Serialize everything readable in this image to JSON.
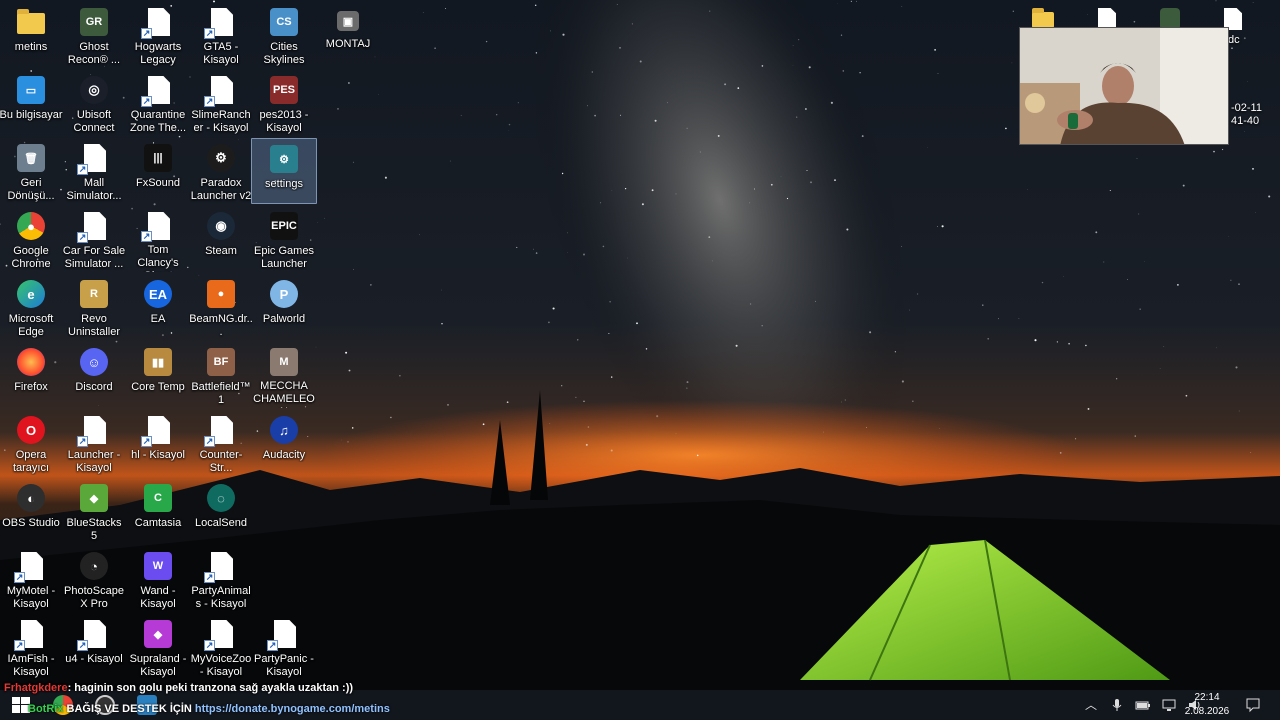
{
  "desktop": {
    "icons": [
      {
        "id": "metins",
        "label": "metins",
        "kind": "folder",
        "col": 0,
        "row": 0,
        "name": "folder-icon"
      },
      {
        "id": "ghostrecon",
        "label": "Ghost Recon® ...",
        "kind": "sq",
        "color": "#3d5a3d",
        "glyph": "GR",
        "col": 1,
        "row": 0,
        "name": "ghost-recon-icon"
      },
      {
        "id": "hogwarts",
        "label": "Hogwarts Legacy",
        "kind": "page",
        "col": 2,
        "row": 0,
        "name": "shortcut-file-icon"
      },
      {
        "id": "gta5",
        "label": "GTA5 - Kisayol",
        "kind": "page",
        "col": 3,
        "row": 0,
        "name": "shortcut-file-icon"
      },
      {
        "id": "cities",
        "label": "Cities Skylines",
        "kind": "sq",
        "color": "#4a90c8",
        "glyph": "CS",
        "col": 4,
        "row": 0,
        "name": "cities-skylines-icon"
      },
      {
        "id": "montaj",
        "label": "MONTAJ",
        "kind": "sq",
        "color": "#6b6b6b",
        "glyph": "▣",
        "col": 5,
        "row": 0,
        "name": "montaj-icon",
        "small": true
      },
      {
        "id": "thispc",
        "label": "Bu bilgisayar",
        "kind": "sq",
        "color": "#2b8fe0",
        "glyph": "▭",
        "col": 0,
        "row": 1,
        "name": "this-pc-icon"
      },
      {
        "id": "ubisoft",
        "label": "Ubisoft Connect",
        "kind": "circ",
        "color": "#1b1f2a",
        "glyph": "◎",
        "col": 1,
        "row": 1,
        "name": "ubisoft-connect-icon"
      },
      {
        "id": "quarantine",
        "label": "Quarantine Zone The...",
        "kind": "page",
        "col": 2,
        "row": 1,
        "name": "shortcut-file-icon"
      },
      {
        "id": "slimerancher",
        "label": "SlimeRancher - Kisayol",
        "kind": "page",
        "col": 3,
        "row": 1,
        "name": "shortcut-file-icon"
      },
      {
        "id": "pes2013",
        "label": "pes2013 - Kisayol",
        "kind": "sq",
        "color": "#8a2b2b",
        "glyph": "PES",
        "col": 4,
        "row": 1,
        "name": "pes2013-icon"
      },
      {
        "id": "recycle",
        "label": "Geri Dönüşü...",
        "kind": "sq",
        "color": "#6d7f8f",
        "glyph": "🗑",
        "col": 0,
        "row": 2,
        "name": "recycle-bin-icon"
      },
      {
        "id": "mall",
        "label": "Mall Simulator...",
        "kind": "page",
        "col": 1,
        "row": 2,
        "name": "shortcut-file-icon"
      },
      {
        "id": "fxsound",
        "label": "FxSound",
        "kind": "sq",
        "color": "#111",
        "glyph": "|||",
        "col": 2,
        "row": 2,
        "name": "fxsound-icon"
      },
      {
        "id": "paradox",
        "label": "Paradox Launcher v2",
        "kind": "circ",
        "color": "#1c1c1c",
        "glyph": "⚙",
        "col": 3,
        "row": 2,
        "name": "paradox-launcher-icon"
      },
      {
        "id": "settings",
        "label": "settings",
        "kind": "sq",
        "color": "#2a7f8f",
        "glyph": "⚙",
        "col": 4,
        "row": 2,
        "name": "settings-icon",
        "selected": true
      },
      {
        "id": "chrome",
        "label": "Google Chrome",
        "kind": "circ",
        "color": "conic-gradient(#ea4335 0 33%,#fbbc05 0 66%,#34a853 0)",
        "glyph": "●",
        "col": 0,
        "row": 3,
        "name": "chrome-icon"
      },
      {
        "id": "carforsale",
        "label": "Car For Sale Simulator ...",
        "kind": "page",
        "col": 1,
        "row": 3,
        "name": "shortcut-file-icon"
      },
      {
        "id": "tomclancy",
        "label": "Tom Clancy's Ghost Reco...",
        "kind": "page",
        "col": 2,
        "row": 3,
        "name": "shortcut-file-icon"
      },
      {
        "id": "steam",
        "label": "Steam",
        "kind": "circ",
        "color": "#1b2838",
        "glyph": "◉",
        "col": 3,
        "row": 3,
        "name": "steam-icon"
      },
      {
        "id": "epic",
        "label": "Epic Games Launcher",
        "kind": "sq",
        "color": "#111",
        "glyph": "EPIC",
        "col": 4,
        "row": 3,
        "name": "epic-games-icon"
      },
      {
        "id": "edge",
        "label": "Microsoft Edge",
        "kind": "circ",
        "color": "linear-gradient(135deg,#36c46b,#1e7bd8)",
        "glyph": "e",
        "col": 0,
        "row": 4,
        "name": "edge-icon"
      },
      {
        "id": "revo",
        "label": "Revo Uninstaller",
        "kind": "sq",
        "color": "#c8a04a",
        "glyph": "R",
        "col": 1,
        "row": 4,
        "name": "revo-uninstaller-icon"
      },
      {
        "id": "ea",
        "label": "EA",
        "kind": "circ",
        "color": "#1766e0",
        "glyph": "EA",
        "col": 2,
        "row": 4,
        "name": "ea-icon"
      },
      {
        "id": "beamng",
        "label": "BeamNG.dr...",
        "kind": "sq",
        "color": "#e86a1a",
        "glyph": "●",
        "col": 3,
        "row": 4,
        "name": "beamng-icon"
      },
      {
        "id": "palworld",
        "label": "Palworld",
        "kind": "circ",
        "color": "#7fb6e6",
        "glyph": "P",
        "col": 4,
        "row": 4,
        "name": "palworld-icon"
      },
      {
        "id": "firefox",
        "label": "Firefox",
        "kind": "circ",
        "color": "radial-gradient(circle,#ffbd4f,#ff4f2e 60%,#6e2cc9)",
        "glyph": "",
        "col": 0,
        "row": 5,
        "name": "firefox-icon"
      },
      {
        "id": "discord",
        "label": "Discord",
        "kind": "circ",
        "color": "#5865f2",
        "glyph": "☺",
        "col": 1,
        "row": 5,
        "name": "discord-icon"
      },
      {
        "id": "coretemp",
        "label": "Core Temp",
        "kind": "sq",
        "color": "#b88a40",
        "glyph": "▮▮",
        "col": 2,
        "row": 5,
        "name": "core-temp-icon"
      },
      {
        "id": "battlefield",
        "label": "Battlefield™ 1",
        "kind": "sq",
        "color": "#8f6048",
        "glyph": "BF",
        "col": 3,
        "row": 5,
        "name": "battlefield-icon"
      },
      {
        "id": "meccha",
        "label": "MECCHA CHAMELEON",
        "kind": "sq",
        "color": "#8a7a70",
        "glyph": "M",
        "col": 4,
        "row": 5,
        "name": "meccha-chameleon-icon"
      },
      {
        "id": "opera",
        "label": "Opera tarayıcı",
        "kind": "circ",
        "color": "#e0141e",
        "glyph": "O",
        "col": 0,
        "row": 6,
        "name": "opera-icon"
      },
      {
        "id": "launcher",
        "label": "Launcher - Kisayol",
        "kind": "page",
        "col": 1,
        "row": 6,
        "name": "shortcut-file-icon"
      },
      {
        "id": "hl",
        "label": "hl - Kisayol",
        "kind": "page",
        "col": 2,
        "row": 6,
        "name": "shortcut-file-icon"
      },
      {
        "id": "counterstrike",
        "label": "Counter-Str...",
        "kind": "page",
        "col": 3,
        "row": 6,
        "name": "shortcut-file-icon"
      },
      {
        "id": "audacity",
        "label": "Audacity",
        "kind": "circ",
        "color": "#1a3ea8",
        "glyph": "♫",
        "col": 4,
        "row": 6,
        "name": "audacity-icon"
      },
      {
        "id": "obs",
        "label": "OBS Studio",
        "kind": "circ",
        "color": "#2e2e2e",
        "glyph": "◐",
        "col": 0,
        "row": 7,
        "name": "obs-studio-icon"
      },
      {
        "id": "bluestacks",
        "label": "BlueStacks 5",
        "kind": "sq",
        "color": "#5aa83a",
        "glyph": "◆",
        "col": 1,
        "row": 7,
        "name": "bluestacks-icon"
      },
      {
        "id": "camtasia",
        "label": "Camtasia",
        "kind": "sq",
        "color": "#29a84a",
        "glyph": "C",
        "col": 2,
        "row": 7,
        "name": "camtasia-icon"
      },
      {
        "id": "localsend",
        "label": "LocalSend",
        "kind": "circ",
        "color": "#0f6b60",
        "glyph": "◌",
        "col": 3,
        "row": 7,
        "name": "localsend-icon"
      },
      {
        "id": "mymotel",
        "label": "MyMotel - Kisayol",
        "kind": "page",
        "col": 0,
        "row": 8,
        "name": "shortcut-file-icon"
      },
      {
        "id": "photoscape",
        "label": "PhotoScape X Pro",
        "kind": "circ",
        "color": "#222",
        "glyph": "◔",
        "col": 1,
        "row": 8,
        "name": "photoscape-icon"
      },
      {
        "id": "wand",
        "label": "Wand - Kisayol",
        "kind": "sq",
        "color": "#6a4cf0",
        "glyph": "W",
        "col": 2,
        "row": 8,
        "name": "wand-icon"
      },
      {
        "id": "partyanimals",
        "label": "PartyAnimals - Kisayol",
        "kind": "page",
        "col": 3,
        "row": 8,
        "name": "shortcut-file-icon"
      },
      {
        "id": "iamfish",
        "label": "IAmFish - Kisayol",
        "kind": "page",
        "col": 0,
        "row": 9,
        "name": "shortcut-file-icon"
      },
      {
        "id": "u4",
        "label": "u4 - Kisayol",
        "kind": "page",
        "col": 1,
        "row": 9,
        "name": "shortcut-file-icon"
      },
      {
        "id": "supraland",
        "label": "Supraland - Kisayol",
        "kind": "sq",
        "color": "#b53ad6",
        "glyph": "◆",
        "col": 2,
        "row": 9,
        "name": "supraland-icon"
      },
      {
        "id": "myvoicezoo",
        "label": "MyVoiceZoo - Kisayol",
        "kind": "page",
        "col": 3,
        "row": 9,
        "name": "shortcut-file-icon"
      },
      {
        "id": "partypanic",
        "label": "PartyPanic - Kisayol",
        "kind": "page",
        "col": 4,
        "row": 9,
        "name": "shortcut-file-icon"
      }
    ],
    "right_icons_partial": [
      {
        "label": "",
        "kind": "folder"
      },
      {
        "label": "",
        "kind": "page"
      },
      {
        "label": "",
        "kind": "sq"
      },
      {
        "label": "dc",
        "kind": "page"
      }
    ],
    "right_partial_text": [
      "-02-11",
      "41-40"
    ]
  },
  "overlay": {
    "chat_user": "Frhatgkdere",
    "chat_message": ": haginin son golu peki tranzona sağ ayakla uzaktan :))",
    "bot_name": "BotRix",
    "donate_text": "BAĞIŞ VE DESTEK İÇİN",
    "donate_url": "https://donate.bynogame.com/metins"
  },
  "taskbar": {
    "time": "22:14",
    "date": "2.08.2026",
    "tray_icons": [
      "chevron-up-icon",
      "microphone-icon",
      "battery-icon",
      "network-icon",
      "volume-icon"
    ],
    "notification_icon": "notification-icon"
  },
  "colors": {
    "accent": "#0078d7",
    "tent": "#7ed321",
    "horizon": "#e06a1a"
  }
}
